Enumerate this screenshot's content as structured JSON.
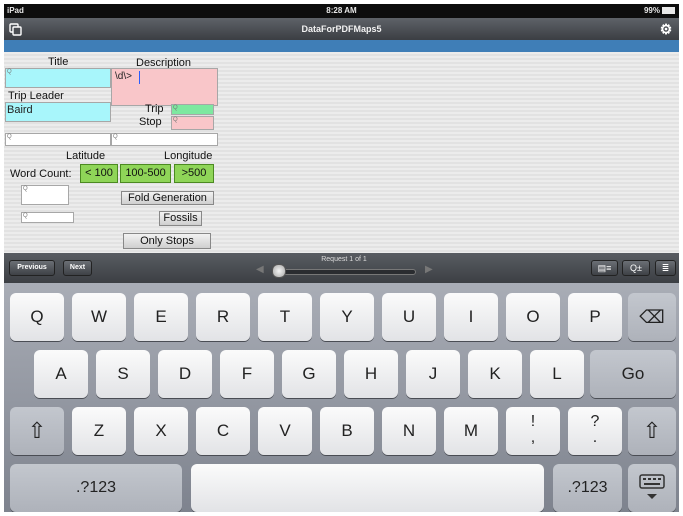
{
  "status_bar": {
    "device": "iPad",
    "time": "8:28 AM",
    "battery": "99%"
  },
  "title_bar": {
    "title": "DataForPDFMaps5",
    "left_icon": "copy-icon",
    "right_icon": "gear-icon"
  },
  "form": {
    "title_label": "Title",
    "description_label": "Description",
    "description_value": "\\d\\>",
    "trip_leader_label": "Trip Leader",
    "trip_leader_value": "Baird",
    "trip_label": "Trip",
    "stop_label": "Stop",
    "latitude_label": "Latitude",
    "longitude_label": "Longitude",
    "word_count_label": "Word Count:",
    "word_count_buttons": [
      "< 100",
      "100-500",
      ">500"
    ],
    "fold_generation_button": "Fold Generation",
    "fossils_button": "Fossils",
    "only_stops_button": "Only Stops",
    "search_glyph": "Q",
    "colors": {
      "cyan_field": "#a8f6fb",
      "pink_field": "#f9c6c9",
      "green_field": "#7ee8a0",
      "green_button": "#8fd558"
    }
  },
  "accessory_bar": {
    "previous_label": "Previous",
    "next_label": "Next",
    "request_label": "Request 1 of 1",
    "left_arrow": "◀",
    "right_arrow": "▶",
    "icons": [
      "list-icon",
      "search-zoom-icon",
      "filter-icon"
    ]
  },
  "keyboard": {
    "row1": [
      "Q",
      "W",
      "E",
      "R",
      "T",
      "Y",
      "U",
      "I",
      "O",
      "P"
    ],
    "row2": [
      "A",
      "S",
      "D",
      "F",
      "G",
      "H",
      "J",
      "K",
      "L"
    ],
    "row3": [
      "Z",
      "X",
      "C",
      "V",
      "B",
      "N",
      "M"
    ],
    "excl_top": "!",
    "excl_bottom": ",",
    "question_top": "?",
    "question_bottom": ".",
    "go_label": "Go",
    "numbers_label": ".?123",
    "backspace_glyph": "⌫",
    "shift_glyph": "⇧",
    "dismiss_icon": "keyboard-dismiss-icon"
  }
}
